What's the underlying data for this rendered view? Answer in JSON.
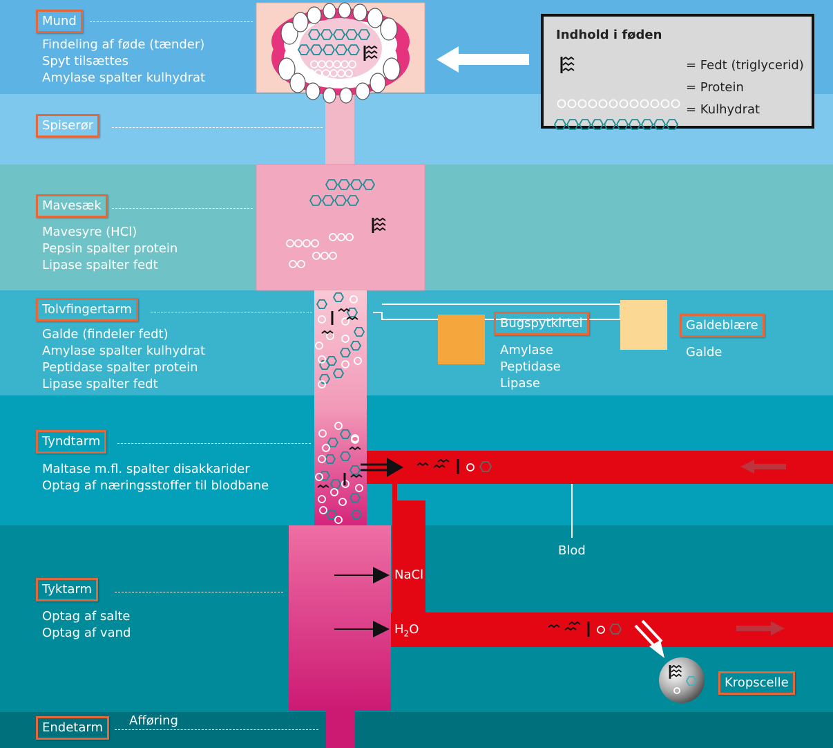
{
  "colors": {
    "band_mouth": "#5db3e3",
    "band_esophagus": "#7ec8ee",
    "band_stomach": "#6fc3c6",
    "band_duodenum": "#39b4cc",
    "band_small_intestine": "#04a0ba",
    "band_large_intestine": "#008a9a",
    "band_rectum": "#00707c",
    "tube": "#f2a9c0",
    "blood": "#e30713",
    "label_border": "#e4683a",
    "pancreas": "#f5a63c",
    "gallbladder": "#fbd894",
    "carb_chain": "#1a8c96",
    "protein_chain": "#ffffff"
  },
  "sections": {
    "mund": {
      "label": "Mund",
      "lines": [
        "Findeling af føde (tænder)",
        "Spyt tilsættes",
        "Amylase spalter kulhydrat"
      ]
    },
    "spiseroer": {
      "label": "Spiserør"
    },
    "mavesaek": {
      "label": "Mavesæk",
      "lines": [
        "Mavesyre (HCl)",
        "Pepsin spalter protein",
        "Lipase spalter fedt"
      ]
    },
    "tolvfingertarm": {
      "label": "Tolvfingertarm",
      "lines": [
        "Galde (findeler fedt)",
        "Amylase spalter kulhydrat",
        "Peptidase spalter protein",
        "Lipase spalter fedt"
      ]
    },
    "tyndtarm": {
      "label": "Tyndtarm",
      "lines": [
        "Maltase m.fl. spalter disakkarider",
        "Optag af næringsstoffer til blodbane"
      ]
    },
    "tyktarm": {
      "label": "Tyktarm",
      "lines": [
        "Optag af salte",
        "Optag af vand"
      ]
    },
    "endetarm": {
      "label": "Endetarm",
      "note": "Afføring"
    }
  },
  "organs": {
    "bugspytkirtel": {
      "label": "Bugspytkirtel",
      "lines": [
        "Amylase",
        "Peptidase",
        "Lipase"
      ]
    },
    "galdeblaere": {
      "label": "Galdeblære",
      "lines": [
        "Galde"
      ]
    }
  },
  "blood": {
    "label": "Blod"
  },
  "absorption": {
    "nacl": "NaCl",
    "h2o_main": "H",
    "h2o_sub": "2",
    "h2o_end": "O"
  },
  "cell": {
    "label": "Kropscelle"
  },
  "legend": {
    "title": "Indhold i føden",
    "rows": [
      {
        "text": "= Fedt (triglycerid)",
        "icon": "fat-icon"
      },
      {
        "text": "= Protein",
        "icon": "protein-chain-icon"
      },
      {
        "text": "= Kulhydrat",
        "icon": "carbohydrate-chain-icon"
      }
    ]
  }
}
